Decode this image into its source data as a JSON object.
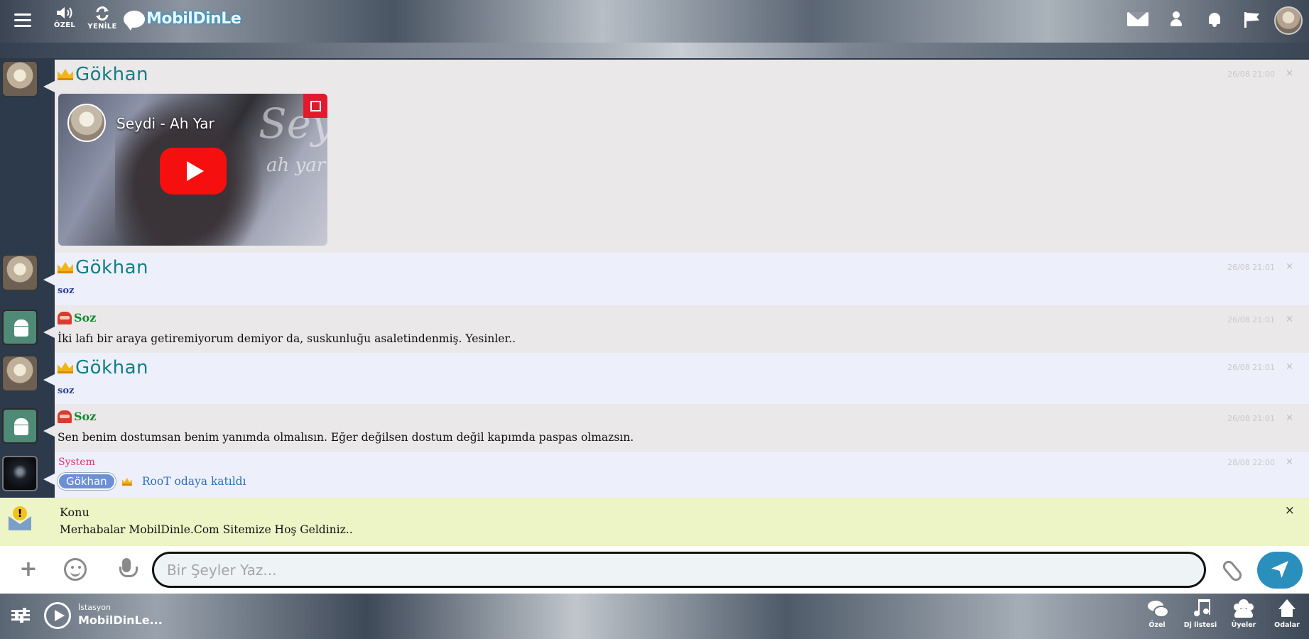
{
  "topbar": {
    "ozel_label": "ÖZEL",
    "yenile_label": "YENİLE",
    "logo_text": "MobilDinLe",
    "icons": [
      "menu-icon",
      "speaker-icon",
      "refresh-icon",
      "mail-icon",
      "user-icon",
      "bell-icon",
      "flag-icon",
      "avatar"
    ]
  },
  "messages": [
    {
      "user": "Gökhan",
      "time": "26/08 21:00",
      "close": "×",
      "video": {
        "title": "Seydi - Ah Yar",
        "overlay_script": "Seydi",
        "overlay_sub": "ah yar"
      }
    },
    {
      "user": "Gökhan",
      "time": "26/08 21:01",
      "close": "×",
      "text": "soz"
    },
    {
      "user": "Soz",
      "time": "26/08 21:01",
      "close": "×",
      "text": "İki lafı bir araya getiremiyorum demiyor da, suskunluğu asaletindenmiş. Yesinler.."
    },
    {
      "user": "Gökhan",
      "time": "26/08 21:01",
      "close": "×",
      "text": "soz"
    },
    {
      "user": "Soz",
      "time": "26/08 21:01",
      "close": "×",
      "text": "Sen benim dostumsan benim yanımda olmalısın. Eğer değilsen dostum değil kapımda paspas olmazsın."
    },
    {
      "user": "System",
      "time": "28/08 22:00",
      "close": "×",
      "join_nick": "Gökhan",
      "join_text": "RooT odaya katıldı"
    }
  ],
  "announcement": {
    "title": "Konu",
    "body": "Merhabalar MobilDinle.Com Sitemize Hoş Geldiniz..",
    "close": "×"
  },
  "composer": {
    "plus": "+",
    "placeholder": "Bir Şeyler Yaz..."
  },
  "bottombar": {
    "radio_line1": "İstasyon",
    "radio_line2": "MobilDinLe...",
    "ozel": "Özel",
    "listem": "Dj listesi",
    "uyeler": "Üyeler",
    "odalar": "Odalar"
  },
  "colors": {
    "nick_gokhan": "#127d86",
    "nick_bot": "#0f8a2e",
    "nick_system": "#e22f6b",
    "announce_bg": "#edf4c6",
    "send_btn": "#2b8fbd",
    "play_red": "#f50f0f"
  }
}
